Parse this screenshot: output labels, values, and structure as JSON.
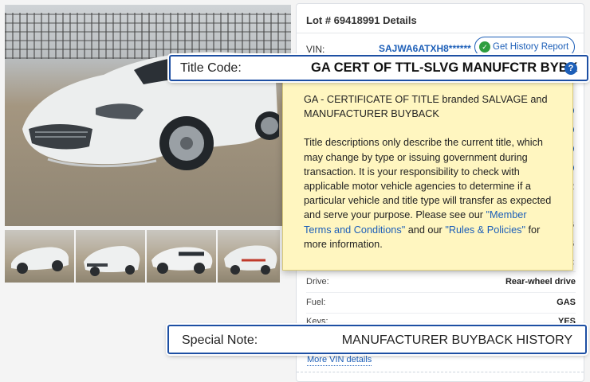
{
  "photos": {
    "main_alt": "White sports car on dirt lot",
    "thumbnails": [
      "front-left view",
      "front view",
      "rear-right view",
      "rear view"
    ]
  },
  "panel": {
    "title": "Lot # 69418991 Details",
    "vin_label": "VIN:",
    "vin_value": "SAJWA6ATXH8******",
    "history_button": "Get History Report",
    "history_icon": "check-circle-icon",
    "peek_values": [
      "R",
      "6",
      "6",
      "C"
    ],
    "rows": [
      {
        "label": "Drive:",
        "value": "Rear-wheel drive"
      },
      {
        "label": "Fuel:",
        "value": "GAS"
      },
      {
        "label": "Keys:",
        "value": "YES"
      }
    ],
    "more_vin": "More VIN details"
  },
  "title_code": {
    "label": "Title Code:",
    "value": "GA CERT OF TTL-SLVG MANUFCTR BYBK",
    "help_icon": "question-circle-icon"
  },
  "tooltip": {
    "line1": "GA - CERTIFICATE OF TITLE branded SALVAGE and MANUFACTURER BUYBACK",
    "para_start": "Title descriptions only describe the current title, which may change by type or issuing government during transaction. It is your responsibility to check with applicable motor vehicle agencies to determine if a particular vehicle and title type will transfer as expected and serve your purpose. Please see our ",
    "link1": "\"Member Terms and Conditions\"",
    "mid": " and our ",
    "link2": "\"Rules & Policies\"",
    "para_end": " for more information."
  },
  "special_note": {
    "label": "Special Note:",
    "value": "MANUFACTURER BUYBACK HISTORY"
  },
  "colors": {
    "accent": "#1d5fb8",
    "callout_border": "#1d4fa3",
    "tooltip_bg": "#fff6c0"
  }
}
